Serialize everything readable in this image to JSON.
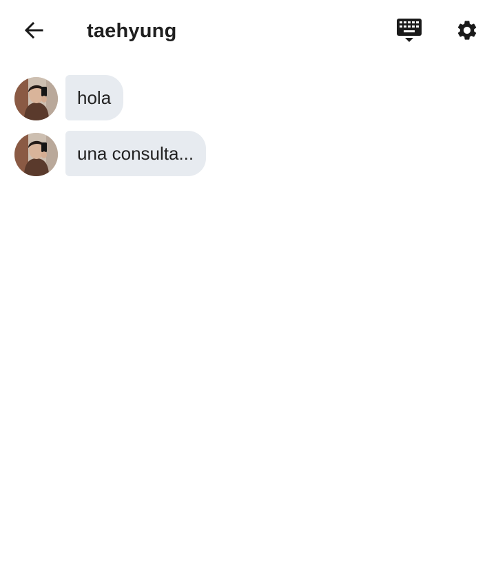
{
  "header": {
    "title": "taehyung",
    "back_icon": "arrow-left-icon",
    "keyboard_icon": "keyboard-hide-icon",
    "settings_icon": "gear-icon"
  },
  "messages": [
    {
      "text": "hola",
      "avatar": "contact-avatar"
    },
    {
      "text": "una consulta...",
      "avatar": "contact-avatar"
    }
  ],
  "colors": {
    "bubble_background": "#e7ebf0",
    "text": "#212121",
    "icon": "#1a1a1a"
  }
}
